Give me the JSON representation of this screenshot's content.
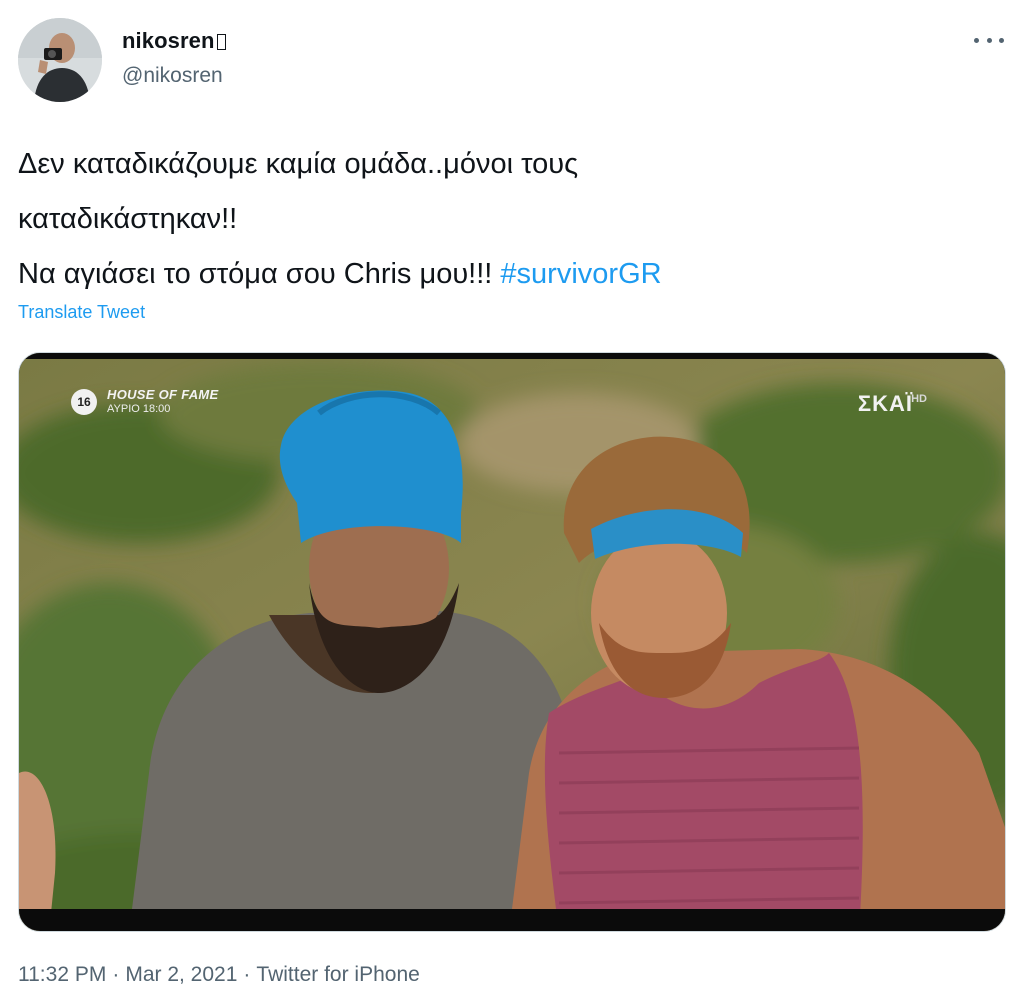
{
  "author": {
    "display_name": "nikosren",
    "handle": "@nikosren"
  },
  "tweet": {
    "text_line1": "Δεν καταδικάζουμε καμία ομάδα..μόνοι τους",
    "text_line2": "καταδικάστηκαν!!",
    "text_line3_prefix": "Να αγιάσει το στόμα σου Chris μου!!! ",
    "hashtag": "#survivorGR",
    "translate_label": "Translate Tweet"
  },
  "media": {
    "promo_rating": "16",
    "promo_title": "HOUSE OF FAME",
    "promo_time": "ΑΥΡΙΟ 18:00",
    "channel_logo": "ΣΚΑΪ",
    "channel_quality": "HD"
  },
  "meta": {
    "time": "11:32 PM",
    "date": "Mar 2, 2021",
    "source": "Twitter for iPhone",
    "separator": "·"
  },
  "icons": {
    "more": "more-horizontal-icon"
  },
  "colors": {
    "link": "#1d9bf0",
    "secondary_text": "#536471",
    "primary_text": "#0f1419"
  }
}
